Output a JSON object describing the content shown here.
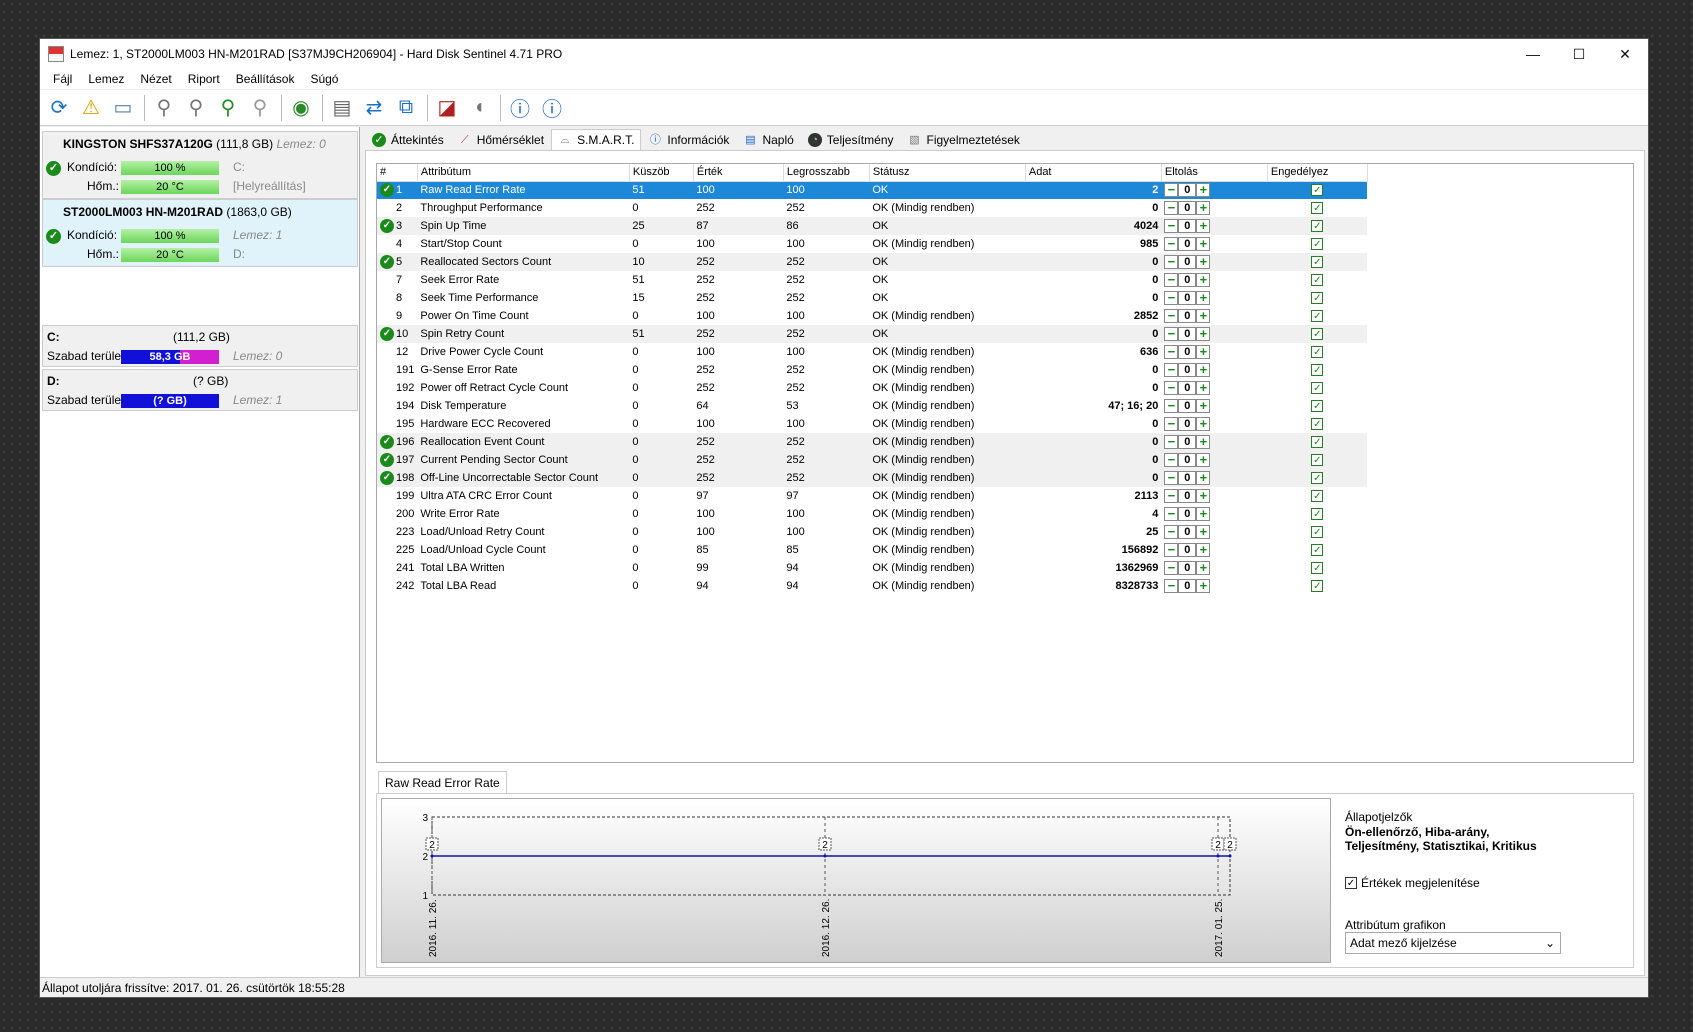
{
  "window": {
    "title": "Lemez: 1, ST2000LM003 HN-M201RAD [S37MJ9CH206904]  -  Hard Disk Sentinel 4.71 PRO",
    "controls": {
      "minimize": "—",
      "maximize": "☐",
      "close": "✕"
    }
  },
  "menu": [
    "Fájl",
    "Lemez",
    "Nézet",
    "Riport",
    "Beállítások",
    "Súgó"
  ],
  "disks": [
    {
      "name": "KINGSTON SHFS37A120G",
      "size": "(111,8 GB)",
      "lemez": "Lemez: 0",
      "kondicio_label": "Kondíció:",
      "kondicio": "100 %",
      "hom_label": "Hőm.:",
      "hom": "20 °C",
      "extra1": "C:",
      "extra2": "[Helyreállítás]"
    },
    {
      "name": "ST2000LM003 HN-M201RAD",
      "size": "(1863,0 GB)",
      "lemez": "Lemez: 1",
      "kondicio_label": "Kondíció:",
      "kondicio": "100 %",
      "hom_label": "Hőm.:",
      "hom": "20 °C",
      "extra1": "D:"
    }
  ],
  "volumes": [
    {
      "letter": "C:",
      "size": "(111,2 GB)",
      "free_label": "Szabad terület",
      "free": "58,3 GB",
      "lemez": "Lemez: 0"
    },
    {
      "letter": "D:",
      "size": "(? GB)",
      "free_label": "Szabad terület",
      "free": "(? GB)",
      "lemez": "Lemez: 1"
    }
  ],
  "status_bar": "Állapot utoljára frissítve: 2017. 01. 26. csütörtök 18:55:28",
  "tabs": [
    "Áttekintés",
    "Hőmérséklet",
    "S.M.A.R.T.",
    "Információk",
    "Napló",
    "Teljesítmény",
    "Figyelmeztetések"
  ],
  "smart": {
    "columns": [
      "#",
      "Attribútum",
      "Küszöb",
      "Érték",
      "Legrosszabb",
      "Státusz",
      "Adat",
      "Eltolás",
      "Engedélyez"
    ],
    "rows": [
      {
        "id": "1",
        "name": "Raw Read Error Rate",
        "threshold": "51",
        "value": "100",
        "worst": "100",
        "status": "OK",
        "data": "2",
        "offset": "0",
        "critical": true
      },
      {
        "id": "2",
        "name": "Throughput Performance",
        "threshold": "0",
        "value": "252",
        "worst": "252",
        "status": "OK (Mindig rendben)",
        "data": "0",
        "offset": "0",
        "critical": false
      },
      {
        "id": "3",
        "name": "Spin Up Time",
        "threshold": "25",
        "value": "87",
        "worst": "86",
        "status": "OK",
        "data": "4024",
        "offset": "0",
        "critical": true
      },
      {
        "id": "4",
        "name": "Start/Stop Count",
        "threshold": "0",
        "value": "100",
        "worst": "100",
        "status": "OK (Mindig rendben)",
        "data": "985",
        "offset": "0",
        "critical": false
      },
      {
        "id": "5",
        "name": "Reallocated Sectors Count",
        "threshold": "10",
        "value": "252",
        "worst": "252",
        "status": "OK",
        "data": "0",
        "offset": "0",
        "critical": true
      },
      {
        "id": "7",
        "name": "Seek Error Rate",
        "threshold": "51",
        "value": "252",
        "worst": "252",
        "status": "OK",
        "data": "0",
        "offset": "0",
        "critical": false
      },
      {
        "id": "8",
        "name": "Seek Time Performance",
        "threshold": "15",
        "value": "252",
        "worst": "252",
        "status": "OK",
        "data": "0",
        "offset": "0",
        "critical": false
      },
      {
        "id": "9",
        "name": "Power On Time Count",
        "threshold": "0",
        "value": "100",
        "worst": "100",
        "status": "OK (Mindig rendben)",
        "data": "2852",
        "offset": "0",
        "critical": false
      },
      {
        "id": "10",
        "name": "Spin Retry Count",
        "threshold": "51",
        "value": "252",
        "worst": "252",
        "status": "OK",
        "data": "0",
        "offset": "0",
        "critical": true
      },
      {
        "id": "12",
        "name": "Drive Power Cycle Count",
        "threshold": "0",
        "value": "100",
        "worst": "100",
        "status": "OK (Mindig rendben)",
        "data": "636",
        "offset": "0",
        "critical": false
      },
      {
        "id": "191",
        "name": "G-Sense Error Rate",
        "threshold": "0",
        "value": "252",
        "worst": "252",
        "status": "OK (Mindig rendben)",
        "data": "0",
        "offset": "0",
        "critical": false
      },
      {
        "id": "192",
        "name": "Power off Retract Cycle Count",
        "threshold": "0",
        "value": "252",
        "worst": "252",
        "status": "OK (Mindig rendben)",
        "data": "0",
        "offset": "0",
        "critical": false
      },
      {
        "id": "194",
        "name": "Disk Temperature",
        "threshold": "0",
        "value": "64",
        "worst": "53",
        "status": "OK (Mindig rendben)",
        "data": "47; 16; 20",
        "offset": "0",
        "critical": false
      },
      {
        "id": "195",
        "name": "Hardware ECC Recovered",
        "threshold": "0",
        "value": "100",
        "worst": "100",
        "status": "OK (Mindig rendben)",
        "data": "0",
        "offset": "0",
        "critical": false
      },
      {
        "id": "196",
        "name": "Reallocation Event Count",
        "threshold": "0",
        "value": "252",
        "worst": "252",
        "status": "OK (Mindig rendben)",
        "data": "0",
        "offset": "0",
        "critical": true
      },
      {
        "id": "197",
        "name": "Current Pending Sector Count",
        "threshold": "0",
        "value": "252",
        "worst": "252",
        "status": "OK (Mindig rendben)",
        "data": "0",
        "offset": "0",
        "critical": true
      },
      {
        "id": "198",
        "name": "Off-Line Uncorrectable Sector Count",
        "threshold": "0",
        "value": "252",
        "worst": "252",
        "status": "OK (Mindig rendben)",
        "data": "0",
        "offset": "0",
        "critical": true
      },
      {
        "id": "199",
        "name": "Ultra ATA CRC Error Count",
        "threshold": "0",
        "value": "97",
        "worst": "97",
        "status": "OK (Mindig rendben)",
        "data": "2113",
        "offset": "0",
        "critical": false
      },
      {
        "id": "200",
        "name": "Write Error Rate",
        "threshold": "0",
        "value": "100",
        "worst": "100",
        "status": "OK (Mindig rendben)",
        "data": "4",
        "offset": "0",
        "critical": false
      },
      {
        "id": "223",
        "name": "Load/Unload Retry Count",
        "threshold": "0",
        "value": "100",
        "worst": "100",
        "status": "OK (Mindig rendben)",
        "data": "25",
        "offset": "0",
        "critical": false
      },
      {
        "id": "225",
        "name": "Load/Unload Cycle Count",
        "threshold": "0",
        "value": "85",
        "worst": "85",
        "status": "OK (Mindig rendben)",
        "data": "156892",
        "offset": "0",
        "critical": false
      },
      {
        "id": "241",
        "name": "Total LBA Written",
        "threshold": "0",
        "value": "99",
        "worst": "94",
        "status": "OK (Mindig rendben)",
        "data": "1362969",
        "offset": "0",
        "critical": false
      },
      {
        "id": "242",
        "name": "Total LBA Read",
        "threshold": "0",
        "value": "94",
        "worst": "94",
        "status": "OK (Mindig rendben)",
        "data": "8328733",
        "offset": "0",
        "critical": false
      }
    ]
  },
  "chart_tab": "Raw Read Error Rate",
  "chart_data": {
    "type": "line",
    "title": "",
    "xlabel": "",
    "ylabel": "",
    "x_ticks": [
      "2016. 11. 26.",
      "2016. 12. 26.",
      "2017. 01. 25."
    ],
    "y_ticks": [
      "3",
      "2",
      "1"
    ],
    "ylim": [
      1,
      3
    ],
    "points": [
      {
        "x": "2016. 11. 26.",
        "y": 2,
        "label": "2"
      },
      {
        "x": "2016. 12. 26.",
        "y": 2,
        "label": "2"
      },
      {
        "x": "2017. 01. 25.",
        "y": 2,
        "label": "2"
      },
      {
        "x": "2017. 01. 26.",
        "y": 2,
        "label": "2"
      }
    ],
    "line_color": "#1010b0",
    "grid": true
  },
  "chart_side": {
    "heading": "Állapotjelzők",
    "indicators": "Ön-ellenőrző, Hiba-arány, Teljesítmény, Statisztikai, Kritikus",
    "show_values_label": "Értékek megjelenítése",
    "graph_label": "Attribútum grafikon",
    "graph_select": "Adat mező kijelzése"
  }
}
